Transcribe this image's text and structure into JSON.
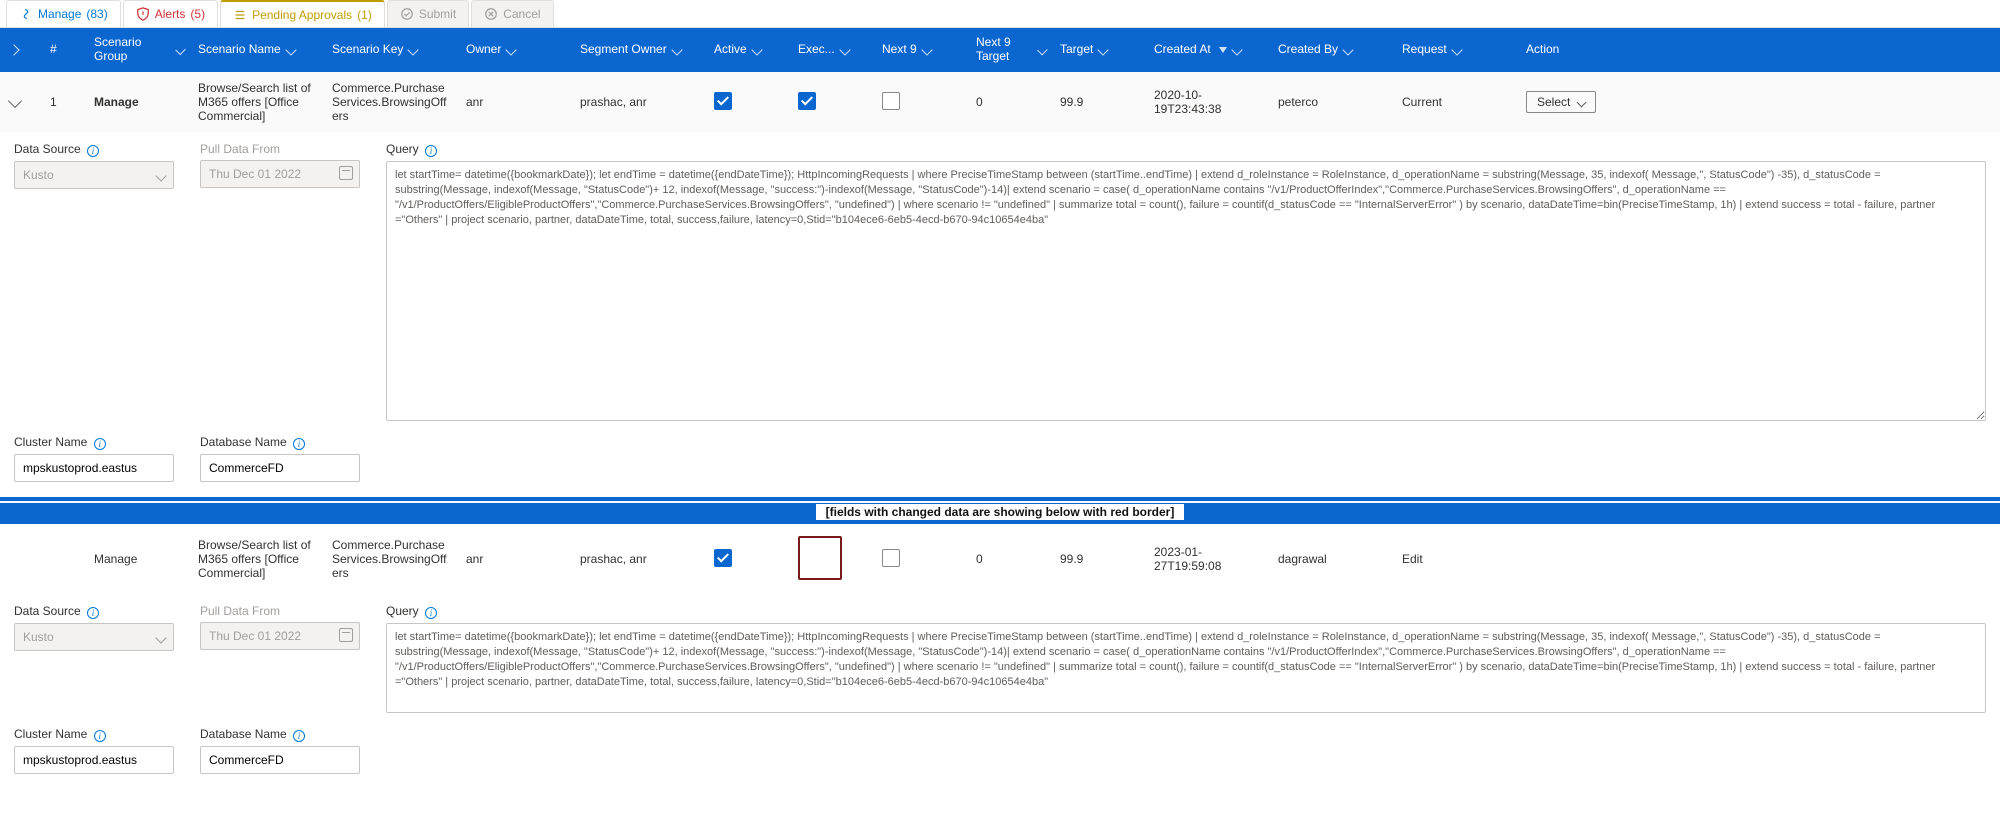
{
  "tabs": {
    "manage": {
      "label": "Manage",
      "count": "(83)"
    },
    "alerts": {
      "label": "Alerts",
      "count": "(5)"
    },
    "pending": {
      "label": "Pending Approvals",
      "count": "(1)"
    },
    "submit": {
      "label": "Submit"
    },
    "cancel": {
      "label": "Cancel"
    }
  },
  "columns": {
    "num": "#",
    "scenario_group": "Scenario Group",
    "scenario_name": "Scenario Name",
    "scenario_key": "Scenario Key",
    "owner": "Owner",
    "segment_owner": "Segment Owner",
    "active": "Active",
    "exec": "Exec...",
    "next9": "Next 9",
    "next9_target": "Next 9 Target",
    "target": "Target",
    "created_at": "Created At",
    "created_by": "Created By",
    "request": "Request",
    "action": "Action"
  },
  "row1": {
    "num": "1",
    "scenario_group": "Manage",
    "scenario_name": "Browse/Search list of M365 offers [Office Commercial]",
    "scenario_key": "Commerce.PurchaseServices.BrowsingOffers",
    "owner": "anr",
    "segment_owner": "prashac, anr",
    "next9_target": "0",
    "target": "99.9",
    "created_at": "2020-10-19T23:43:38",
    "created_by": "peterco",
    "request": "Current",
    "action_label": "Select"
  },
  "detail": {
    "data_source_label": "Data Source",
    "data_source_value": "Kusto",
    "pull_data_label": "Pull Data From",
    "pull_data_value": "Thu Dec 01 2022",
    "query_label": "Query",
    "cluster_label": "Cluster Name",
    "cluster_value": "mpskustoprod.eastus",
    "db_label": "Database Name",
    "db_value": "CommerceFD",
    "query_text": "let startTime= datetime({bookmarkDate});    let endTime = datetime({endDateTime});    HttpIncomingRequests  | where PreciseTimeStamp  between (startTime..endTime)   | extend d_roleInstance = RoleInstance, d_operationName = substring(Message, 35, indexof( Message,\", StatusCode\") -35), d_statusCode = substring(Message, indexof(Message, \"StatusCode\")+ 12, indexof(Message, \"success:\")-indexof(Message, \"StatusCode\")-14)| extend scenario = case(  d_operationName contains \"/v1/ProductOfferIndex\",\"Commerce.PurchaseServices.BrowsingOffers\", d_operationName == \"/v1/ProductOffers/EligibleProductOffers\",\"Commerce.PurchaseServices.BrowsingOffers\",  \"undefined\")   | where scenario != \"undefined\"    | summarize total = count(), failure = countif(d_statusCode == \"InternalServerError\" ) by scenario, dataDateTime=bin(PreciseTimeStamp, 1h) | extend success = total - failure, partner =\"Others\"   | project scenario, partner, dataDateTime, total, success,failure, latency=0,Stid=\"b104ece6-6eb5-4ecd-b670-94c10654e4ba\""
  },
  "separator_text": "[fields with changed data are showing below with red border]",
  "row2": {
    "scenario_group": "Manage",
    "scenario_name": "Browse/Search list of M365 offers [Office Commercial]",
    "scenario_key": "Commerce.PurchaseServices.BrowsingOffers",
    "owner": "anr",
    "segment_owner": "prashac, anr",
    "next9_target": "0",
    "target": "99.9",
    "created_at": "2023-01-27T19:59:08",
    "created_by": "dagrawal",
    "request": "Edit"
  }
}
